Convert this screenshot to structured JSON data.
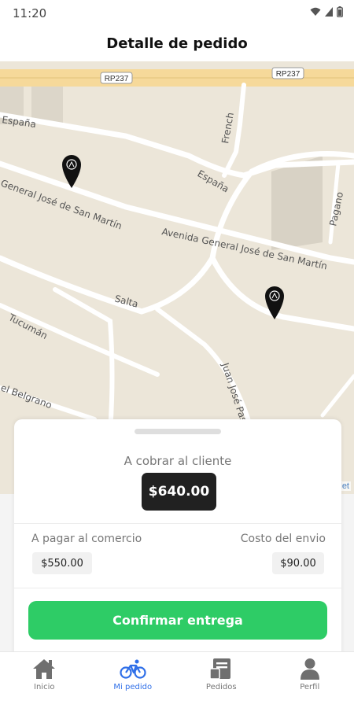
{
  "status_bar": {
    "time": "11:20",
    "icons": [
      "wifi-icon",
      "signal-icon",
      "battery-icon"
    ]
  },
  "header": {
    "title": "Detalle de pedido"
  },
  "map": {
    "street_labels": {
      "road_shield_1": "RP237",
      "road_shield_2": "RP237",
      "espana_left": "España",
      "espana_right": "España",
      "french": "French",
      "san_martin_left": "General José de San Martín",
      "san_martin_right": "Avenida General José de San Martín",
      "pagano": "Pagano",
      "salta": "Salta",
      "tucuman": "Tucumán",
      "juan_jose_paso": "Juan José Pas",
      "belgrano": "el Belgrano"
    },
    "markers": [
      "location-pin-icon",
      "location-pin-icon"
    ],
    "attribution": "let"
  },
  "order_sheet": {
    "collect_label": "A cobrar al cliente",
    "collect_amount": "$640.00",
    "pay_label": "A pagar al comercio",
    "pay_amount": "$550.00",
    "ship_label": "Costo del envio",
    "ship_amount": "$90.00",
    "confirm_label": "Confirmar entrega"
  },
  "bottom_nav": {
    "items": [
      {
        "label": "Inicio",
        "icon": "home-icon",
        "active": false
      },
      {
        "label": "Mi pedido",
        "icon": "bicycle-icon",
        "active": true
      },
      {
        "label": "Pedidos",
        "icon": "orders-icon",
        "active": false
      },
      {
        "label": "Perfil",
        "icon": "person-icon",
        "active": false
      }
    ]
  },
  "colors": {
    "accent_green": "#2ecc66",
    "active_blue": "#2f6fe8",
    "amount_dark": "#212121",
    "map_background": "#ece6d9"
  }
}
